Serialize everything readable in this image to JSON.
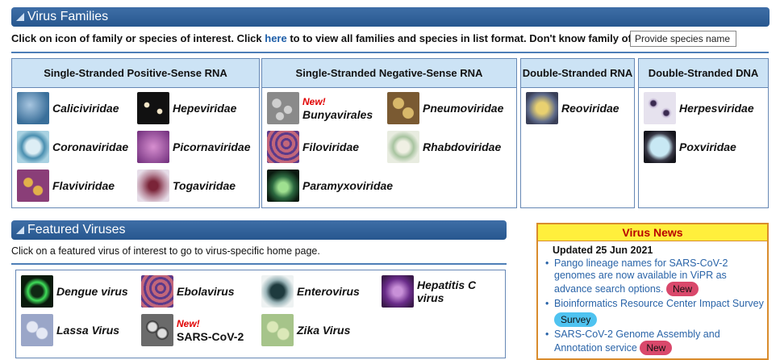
{
  "families_header": {
    "title": "Virus Families"
  },
  "instructions": {
    "text_before": "Click on icon of family or species of interest. Click ",
    "link": "here",
    "text_after": " to to view all families and species in list format. Don't know family of species?"
  },
  "species_search": {
    "value": "Provide species name"
  },
  "panels": [
    {
      "title": "Single-Stranded Positive-Sense RNA",
      "items": [
        "Caliciviridae",
        "Hepeviridae",
        "Coronaviridae",
        "Picornaviridae",
        "Flaviviridae",
        "Togaviridae"
      ]
    },
    {
      "title": "Single-Stranded Negative-Sense RNA",
      "items": [
        "Bunyavirales",
        "Pneumoviridae",
        "Filoviridae",
        "Rhabdoviridae",
        "Paramyxoviridae"
      ],
      "new_tag": "New!"
    },
    {
      "title": "Double-Stranded RNA",
      "items": [
        "Reoviridae"
      ]
    },
    {
      "title": "Double-Stranded DNA",
      "items": [
        "Herpesviridae",
        "Poxviridae"
      ]
    }
  ],
  "featured_header": {
    "title": "Featured Viruses"
  },
  "featured_instructions": "Click on a featured virus of interest to go to virus-specific home page.",
  "featured": {
    "items": [
      "Dengue virus",
      "Ebolavirus",
      "Enterovirus",
      "Hepatitis C virus",
      "Lassa Virus",
      "SARS-CoV-2",
      "Zika Virus"
    ],
    "new_tag": "New!"
  },
  "news": {
    "title": "Virus News",
    "updated": "Updated 25 Jun 2021",
    "items": [
      {
        "text": "Pango lineage names for SARS-CoV-2 genomes are now available in ViPR as advance search options.",
        "badge": "New"
      },
      {
        "text": "Bioinformatics Resource Center Impact Survey",
        "badge": "Survey"
      },
      {
        "text": "SARS-CoV-2 Genome Assembly and Annotation service",
        "badge": "New"
      }
    ]
  },
  "colors": {
    "header_bar": "#27578f",
    "panel_header": "#cce3f5",
    "new_badge": "#d9486b",
    "survey_badge": "#4fc3f0",
    "news_title_bg": "#ffef3c"
  }
}
